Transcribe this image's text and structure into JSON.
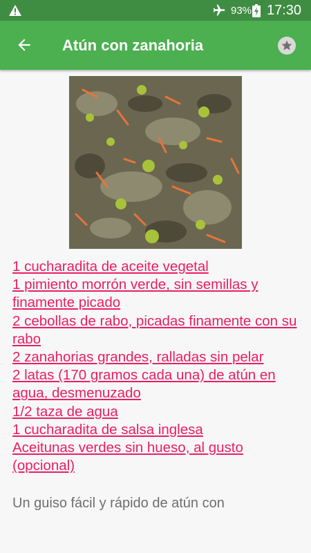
{
  "status_bar": {
    "battery_percent": "93%",
    "time": "17:30"
  },
  "app_bar": {
    "title": "Atún con zanahoria"
  },
  "colors": {
    "status_bar": "#3f8d43",
    "app_bar": "#4caf50",
    "link": "#e91e63",
    "body_text": "#6e6e6e",
    "background": "#f7f7f7"
  },
  "icons": {
    "status_warning": "warning-icon",
    "airplane": "airplane-mode-icon",
    "battery": "battery-charging-icon",
    "back": "arrow-back-icon",
    "favorite": "star-icon"
  },
  "ingredients": [
    "1 cucharadita de aceite vegetal",
    "1 pimiento morrón verde, sin semillas y finamente picado",
    "2 cebollas de rabo, picadas finamente con su rabo",
    "2 zanahorias grandes, ralladas sin pelar",
    "2 latas (170 gramos cada una) de atún en agua, desmenuzado",
    "1/2 taza de agua",
    "1 cucharadita de salsa inglesa",
    "Aceitunas verdes sin hueso, al gusto (opcional)"
  ],
  "description": "Un guiso fácil y rápido de atún con"
}
